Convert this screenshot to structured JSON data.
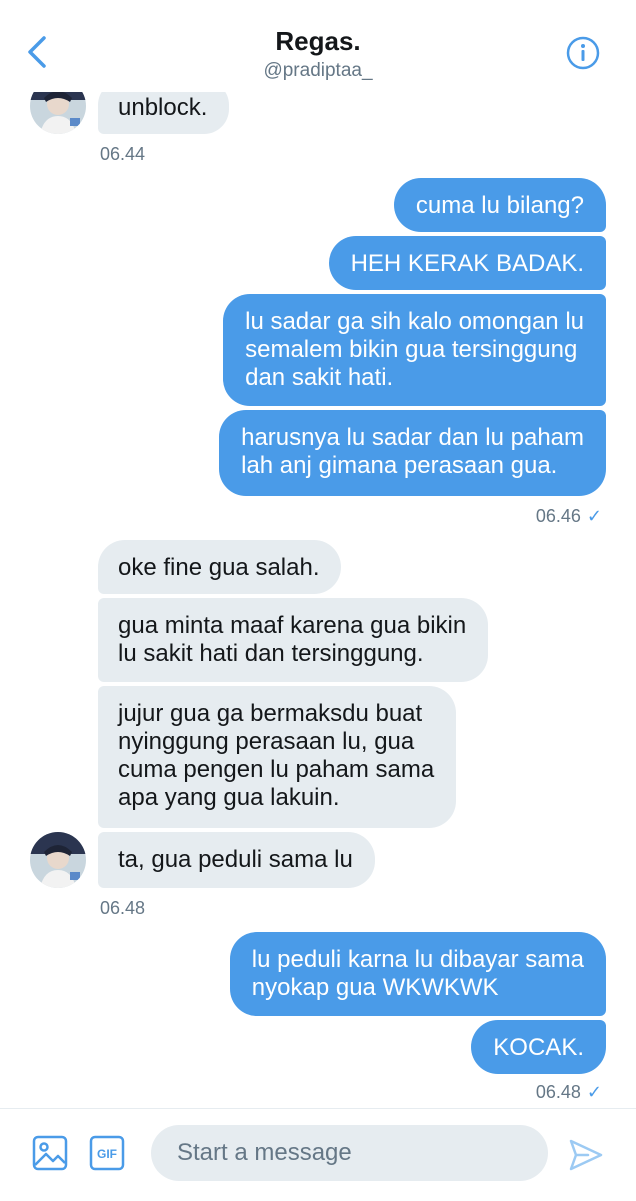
{
  "header": {
    "title": "Regas.",
    "handle": "@pradiptaa_"
  },
  "messages": {
    "m1": "unblock.",
    "ts1": "06.44",
    "m2": "cuma lu bilang?",
    "m3": "HEH KERAK BADAK.",
    "m4_l1": "lu sadar ga sih kalo omongan lu",
    "m4_l2": "semalem bikin gua tersinggung",
    "m4_l3": "dan sakit hati.",
    "m5_l1": "harusnya lu sadar dan lu paham",
    "m5_l2": "lah anj gimana perasaan gua.",
    "ts2": "06.46",
    "m6": "oke fine gua salah.",
    "m7_l1": "gua minta maaf karena gua bikin",
    "m7_l2": "lu sakit hati dan tersinggung.",
    "m8_l1": "jujur gua ga bermaksdu buat",
    "m8_l2": "nyinggung perasaan lu, gua",
    "m8_l3": "cuma pengen lu paham sama",
    "m8_l4": "apa yang gua lakuin.",
    "m9": "ta, gua peduli sama lu",
    "ts3": "06.48",
    "m10_l1": "lu peduli karna lu dibayar sama",
    "m10_l2": "nyokap gua WKWKWK",
    "m11": "KOCAK.",
    "ts4": "06.48",
    "check": "✓"
  },
  "composer": {
    "placeholder": "Start a message",
    "gif_label": "GIF"
  },
  "colors": {
    "accent": "#4a9be8",
    "incoming_bubble": "#e6ecf0",
    "muted_text": "#657786"
  },
  "icons": {
    "back": "chevron-left-icon",
    "info": "info-icon",
    "image": "image-icon",
    "gif": "gif-icon",
    "send": "send-icon"
  }
}
